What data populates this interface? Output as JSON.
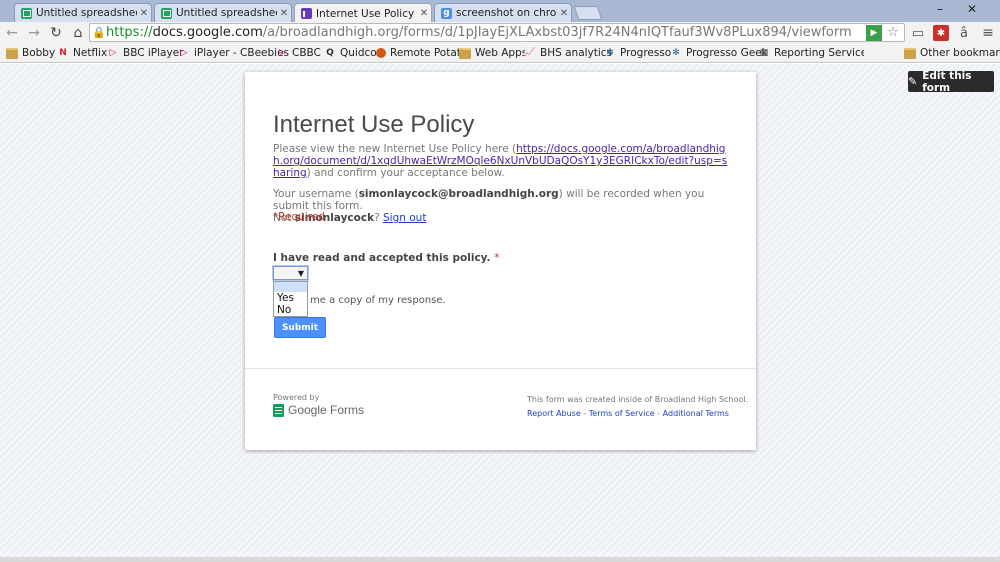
{
  "tabs": [
    {
      "title": "Untitled spreadsheet - G",
      "icon": "sheets-icon"
    },
    {
      "title": "Untitled spreadsheet - G",
      "icon": "sheets-icon"
    },
    {
      "title": "Internet Use Policy",
      "icon": "forms-icon"
    },
    {
      "title": "screenshot on chromebo",
      "icon": "google-search-icon"
    }
  ],
  "window_controls": {
    "minimize": "–",
    "close": "✕"
  },
  "address_bar": {
    "scheme": "https://",
    "host": "docs.google.com",
    "path": "/a/broadlandhigh.org/forms/d/1pJIayEjXLAxbst03jf7R24N4nIQTfauf3Wv8PLux894/viewform"
  },
  "bookmarks": [
    {
      "label": "Bobby",
      "icon": "folder-icon"
    },
    {
      "label": "Netflix",
      "icon": "netflix-icon"
    },
    {
      "label": "BBC iPlayer",
      "icon": "bbc-iplayer-icon"
    },
    {
      "label": "iPlayer - CBeebies",
      "icon": "bbc-iplayer-icon"
    },
    {
      "label": "CBBC",
      "icon": "bbc-iplayer-icon"
    },
    {
      "label": "Quidco",
      "icon": "quidco-icon"
    },
    {
      "label": "Remote Potato",
      "icon": "remote-potato-icon"
    },
    {
      "label": "Web Apps",
      "icon": "folder-icon"
    },
    {
      "label": "BHS analytics",
      "icon": "analytics-icon"
    },
    {
      "label": "Progresso",
      "icon": "progresso-icon"
    },
    {
      "label": "Progresso Geek",
      "icon": "progresso-icon"
    },
    {
      "label": "Reporting Services tr",
      "icon": "reporting-icon"
    },
    {
      "label": "Other bookmarks",
      "icon": "folder-icon"
    }
  ],
  "edit_button": "Edit this form",
  "form": {
    "title": "Internet Use Policy",
    "description_prefix": "Please view the new Internet Use Policy here (",
    "policy_link": "https://docs.google.com/a/broadlandhigh.org/document/d/1xqdUhwaEtWrzMOqle6NxUnVbUDaQOsY1y3EGRICkxTo/edit?usp=sharing",
    "description_suffix": ") and confirm your acceptance below.",
    "username_prefix": "Your username (",
    "username": "simonlaycock@broadlandhigh.org",
    "username_suffix": ") will be recorded when you submit this form.",
    "not_prefix": "Not ",
    "not_user": "simonlaycock",
    "not_suffix": "? ",
    "sign_out": "Sign out",
    "required_note": "*Required",
    "question": "I have read and accepted this policy.",
    "question_required_mark": "*",
    "select_value": "",
    "options": [
      "Yes",
      "No"
    ],
    "copy_response": "me a copy of my response.",
    "submit": "Submit"
  },
  "footer": {
    "powered_by": "Powered by",
    "forms_brand": "Google Forms",
    "created_note": "This form was created inside of Broadland High School.",
    "links": [
      "Report Abuse",
      "Terms of Service",
      "Additional Terms"
    ],
    "separator": " - "
  }
}
